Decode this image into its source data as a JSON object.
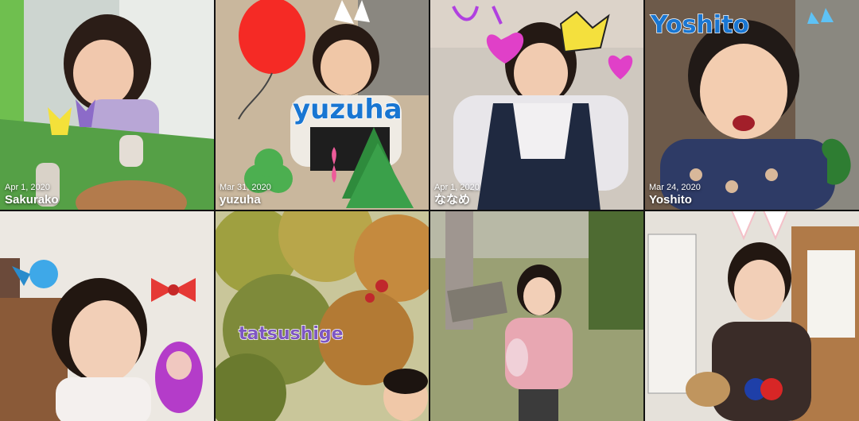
{
  "tiles": [
    {
      "date": "Apr 1, 2020",
      "name": "Sakurako",
      "sticker": ""
    },
    {
      "date": "Mar 31, 2020",
      "name": "yuzuha",
      "sticker": "yuzuha"
    },
    {
      "date": "Apr 1, 2020",
      "name": "ななめ",
      "sticker": ""
    },
    {
      "date": "Mar 24, 2020",
      "name": "Yoshito",
      "sticker": "Yoshito"
    },
    {
      "date": "",
      "name": "",
      "sticker": ""
    },
    {
      "date": "",
      "name": "",
      "sticker": "tatsushige"
    },
    {
      "date": "",
      "name": "",
      "sticker": ""
    },
    {
      "date": "",
      "name": "",
      "sticker": ""
    }
  ],
  "colors": {
    "background": "#101010",
    "sticker_blue": "#1976d2",
    "sticker_purple": "#7e57c2"
  }
}
